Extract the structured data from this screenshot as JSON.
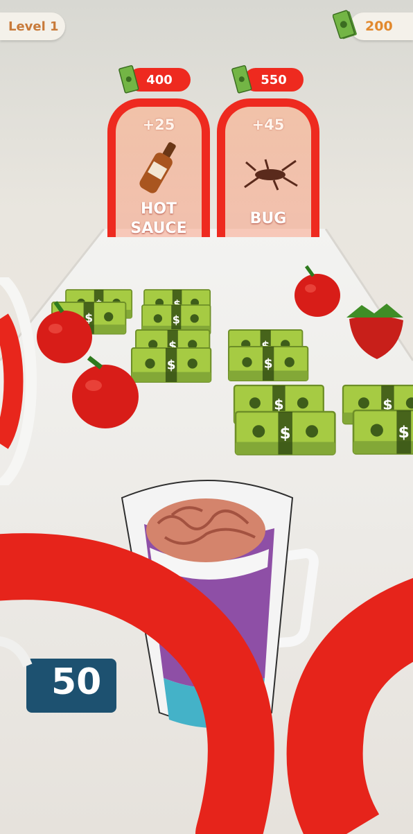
{
  "hud": {
    "level_label": "Level 1",
    "money": "200",
    "money_icon": "cash-icon"
  },
  "gates": [
    {
      "price": "400",
      "bonus": "+25",
      "name_line1": "HOT",
      "name_line2": "SAUCE",
      "item_icon": "hot-sauce-bottle-icon"
    },
    {
      "price": "550",
      "bonus": "+45",
      "name_line1": "BUG",
      "name_line2": "",
      "item_icon": "bug-icon"
    }
  ],
  "track_items": {
    "cash_stack_icon": "cash-stack-icon",
    "fruit_icons": [
      "apple-icon",
      "strawberry-icon"
    ]
  },
  "player": {
    "cup_icon": "mug-icon",
    "contents_icon": "brain-icon",
    "liquid_color": "#8e4fa6"
  },
  "counter_partial": "50",
  "colors": {
    "gate_red": "#ee2a1f",
    "pill_bg": "#f4f1ea",
    "level_text": "#c87a3a",
    "money_text": "#e2892d",
    "counter_bg": "#1d5170"
  }
}
